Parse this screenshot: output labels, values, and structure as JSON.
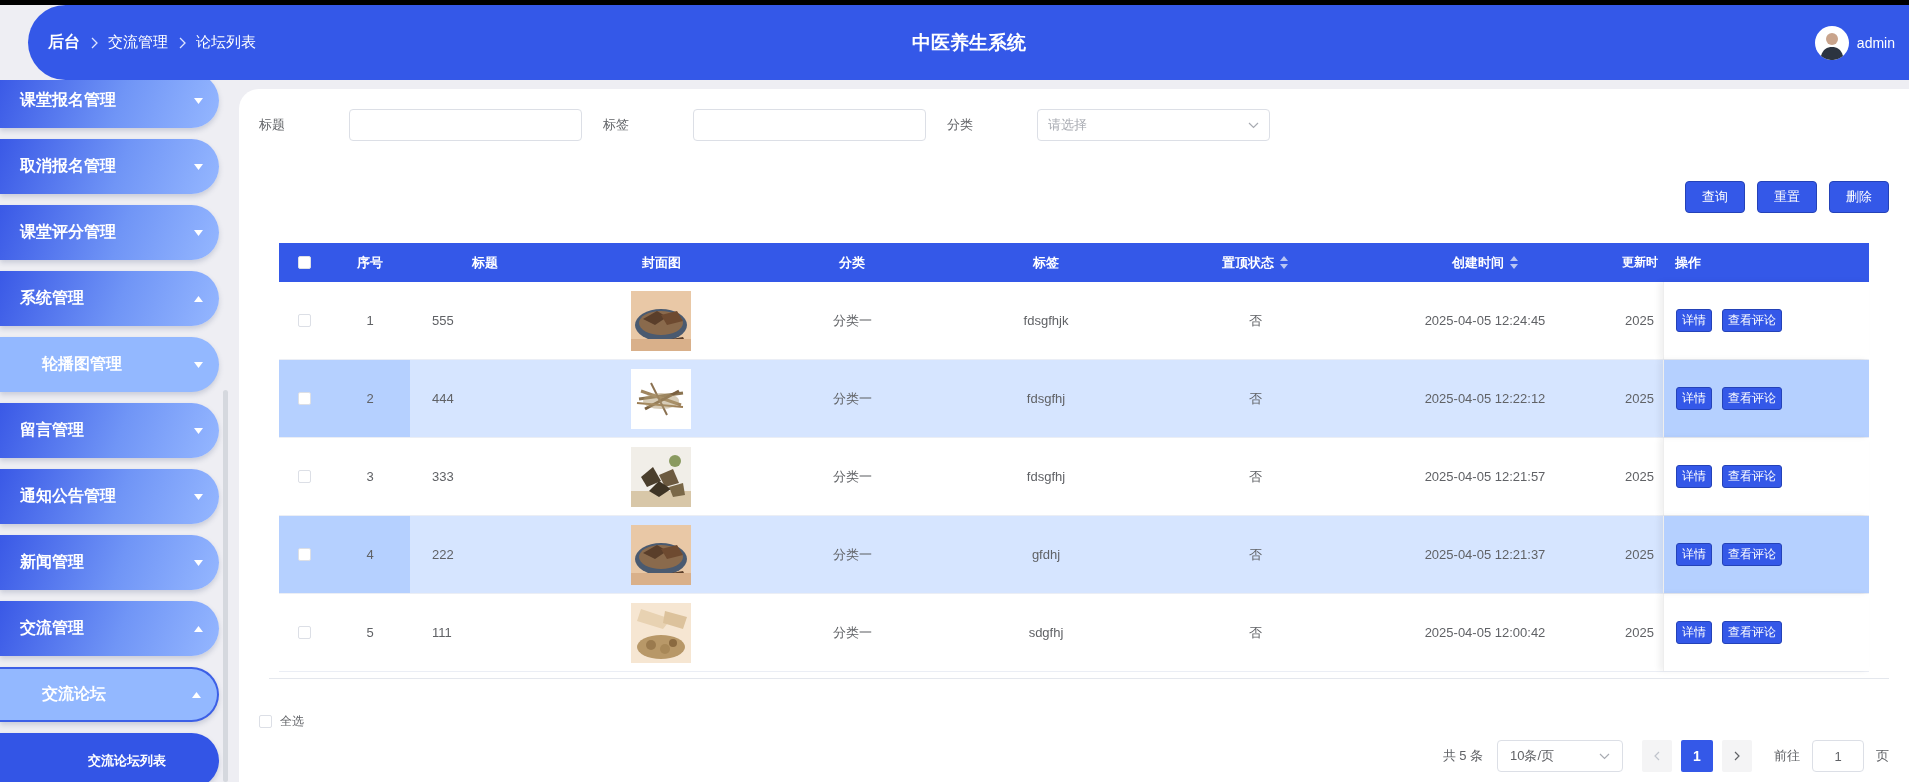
{
  "header": {
    "breadcrumb": [
      "后台",
      "交流管理",
      "论坛列表"
    ],
    "title": "中医养生系统",
    "user": "admin"
  },
  "sidebar": {
    "items": [
      {
        "label": "课堂报名管理",
        "expanded": false
      },
      {
        "label": "取消报名管理",
        "expanded": false
      },
      {
        "label": "课堂评分管理",
        "expanded": false
      },
      {
        "label": "系统管理",
        "expanded": true,
        "children": [
          {
            "label": "轮播图管理",
            "expanded": false
          }
        ]
      },
      {
        "label": "留言管理",
        "expanded": false
      },
      {
        "label": "通知公告管理",
        "expanded": false
      },
      {
        "label": "新闻管理",
        "expanded": false
      },
      {
        "label": "交流管理",
        "expanded": true,
        "children": [
          {
            "label": "交流论坛",
            "expanded": true,
            "children": [
              {
                "label": "交流论坛列表",
                "selected": true
              }
            ]
          }
        ]
      }
    ]
  },
  "filters": [
    {
      "label": "标题",
      "kind": "text"
    },
    {
      "label": "标签",
      "kind": "text"
    },
    {
      "label": "分类",
      "kind": "select",
      "placeholder": "请选择"
    }
  ],
  "buttons": [
    "查询",
    "重置",
    "删除"
  ],
  "table": {
    "all_checked": false,
    "columns": [
      {
        "label": "序号",
        "sortable": false
      },
      {
        "label": "标题",
        "sortable": false
      },
      {
        "label": "封面图",
        "sortable": false
      },
      {
        "label": "分类",
        "sortable": false
      },
      {
        "label": "标签",
        "sortable": false
      },
      {
        "label": "置顶状态",
        "sortable": true
      },
      {
        "label": "创建时间",
        "sortable": true
      },
      {
        "label": "更新时",
        "sortable": false
      },
      {
        "label": "操作",
        "sortable": false
      }
    ],
    "rows": [
      {
        "checked": false,
        "index": "1",
        "title": "555",
        "cover": {
          "kind": "picture"
        },
        "category": "分类一",
        "tag": "fdsgfhjk",
        "pinned": "否",
        "created": "2025-04-05 12:24:45",
        "updated": "2025",
        "actions": [
          "详情",
          "查看评论"
        ]
      },
      {
        "checked": false,
        "index": "2",
        "title": "444",
        "cover": {
          "kind": "picture"
        },
        "category": "分类一",
        "tag": "fdsgfhj",
        "pinned": "否",
        "created": "2025-04-05 12:22:12",
        "updated": "2025",
        "actions": [
          "详情",
          "查看评论"
        ]
      },
      {
        "checked": false,
        "index": "3",
        "title": "333",
        "cover": {
          "kind": "picture"
        },
        "category": "分类一",
        "tag": "fdsgfhj",
        "pinned": "否",
        "created": "2025-04-05 12:21:57",
        "updated": "2025",
        "actions": [
          "详情",
          "查看评论"
        ]
      },
      {
        "checked": false,
        "index": "4",
        "title": "222",
        "cover": {
          "kind": "picture"
        },
        "category": "分类一",
        "tag": "gfdhj",
        "pinned": "否",
        "created": "2025-04-05 12:21:37",
        "updated": "2025",
        "actions": [
          "详情",
          "查看评论"
        ]
      },
      {
        "checked": false,
        "index": "5",
        "title": "111",
        "cover": {
          "kind": "picture"
        },
        "category": "分类一",
        "tag": "sdgfhj",
        "pinned": "否",
        "created": "2025-04-05 12:00:42",
        "updated": "2025",
        "actions": [
          "详情",
          "查看评论"
        ]
      }
    ]
  },
  "select_all": {
    "label": "全选",
    "checked": false
  },
  "pagination": {
    "total": "共 5 条",
    "page_size": "10条/页",
    "pages": [
      {
        "label": "1",
        "selected": true
      }
    ],
    "goto_label": "前往",
    "goto_value": "1",
    "goto_suffix": "页"
  }
}
